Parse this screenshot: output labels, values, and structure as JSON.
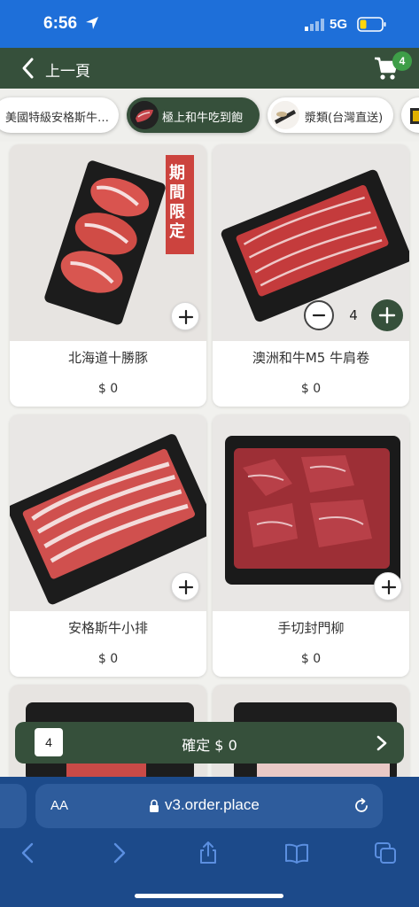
{
  "status_bar": {
    "time": "6:56",
    "network": "5G"
  },
  "header": {
    "back_label": "上一頁",
    "cart_count": "4"
  },
  "tabs": [
    {
      "label": "美國特級安格斯牛…",
      "active": false
    },
    {
      "label": "極上和牛吃到飽",
      "active": true
    },
    {
      "label": "漿類(台灣直送)",
      "active": false
    }
  ],
  "products": [
    {
      "name": "北海道十勝豚",
      "price": "$ 0",
      "badge": "期間限定"
    },
    {
      "name": "澳洲和牛M5 牛肩卷",
      "price": "$ 0",
      "quantity": "4"
    },
    {
      "name": "安格斯牛小排",
      "price": "$ 0"
    },
    {
      "name": "手切封門柳",
      "price": "$ 0"
    }
  ],
  "confirm": {
    "count": "4",
    "label": "確定 $ 0"
  },
  "browser": {
    "text_size": "AA",
    "url": "v3.order.place"
  },
  "colors": {
    "primary": "#36503b",
    "status_bar": "#1e6fd9",
    "browser": "#1c4a8a",
    "badge": "#3e9e48"
  }
}
